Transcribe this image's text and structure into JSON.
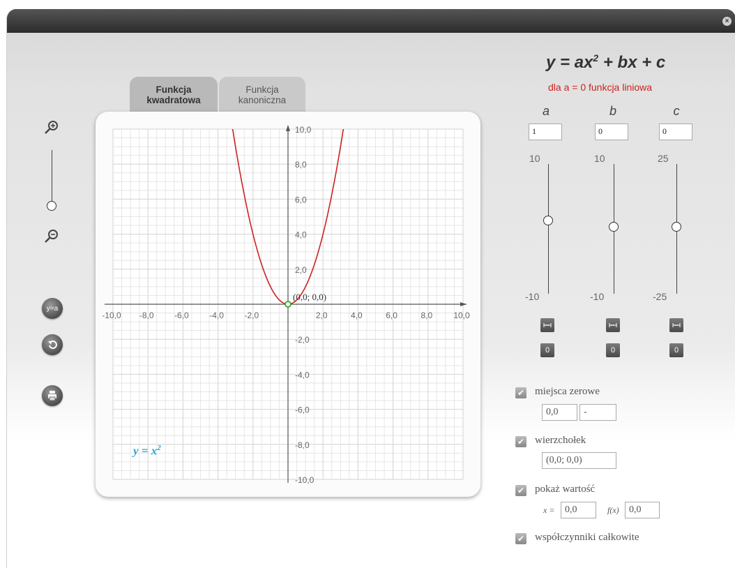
{
  "window": {
    "close_symbol": "×"
  },
  "tabs": [
    {
      "line1": "Funkcja",
      "line2": "kwadratowa",
      "active": true
    },
    {
      "line1": "Funkcja",
      "line2": "kanoniczna",
      "active": false
    }
  ],
  "left_tools": {
    "zoom_in_icon": "zoom-in-icon",
    "zoom_out_icon": "zoom-out-icon",
    "y_eq_a_label": "y=a",
    "undo_icon": "undo-icon",
    "print_icon": "print-icon"
  },
  "chart_data": {
    "type": "line",
    "xlim": [
      -10,
      10
    ],
    "ylim": [
      -10,
      10
    ],
    "grid": true,
    "x_ticks": [
      "-10,0",
      "-8,0",
      "-6,0",
      "-4,0",
      "-2,0",
      "2,0",
      "4,0",
      "6,0",
      "8,0",
      "10,0"
    ],
    "y_ticks": [
      "10,0",
      "8,0",
      "6,0",
      "4,0",
      "2,0",
      "-2,0",
      "-4,0",
      "-6,0",
      "-8,0",
      "-10,0"
    ],
    "function": {
      "a": 1,
      "b": 0,
      "c": 0
    },
    "vertex_label": "(0,0; 0,0)",
    "curve_color": "#cc2222",
    "point_color": "#33aa33"
  },
  "function_label": {
    "prefix": "y = x",
    "exp": "2"
  },
  "formula": {
    "text": "y = ax",
    "exp": "2",
    "rest": " + bx + c"
  },
  "formula_note": "dla a = 0 funkcja liniowa",
  "coefficients": [
    {
      "name": "a",
      "value": "1",
      "max": "10",
      "min": "-10",
      "position": 0.55
    },
    {
      "name": "b",
      "value": "0",
      "max": "10",
      "min": "-10",
      "position": 0.5
    },
    {
      "name": "c",
      "value": "0",
      "max": "25",
      "min": "-25",
      "position": 0.5
    }
  ],
  "reset_label": "0",
  "options": {
    "zeros": {
      "label": "miejsca zerowe",
      "checked": true,
      "values": [
        "0,0",
        "-"
      ]
    },
    "vertex": {
      "label": "wierzchołek",
      "checked": true,
      "value": "(0,0; 0,0)"
    },
    "show_value": {
      "label": "pokaż wartość",
      "checked": true,
      "x_label": "x =",
      "x_value": "0,0",
      "fx_label": "f(x)",
      "fx_value": "0,0"
    },
    "integer_coefs": {
      "label": "współczynniki całkowite",
      "checked": true
    }
  },
  "check_symbol": "✔"
}
